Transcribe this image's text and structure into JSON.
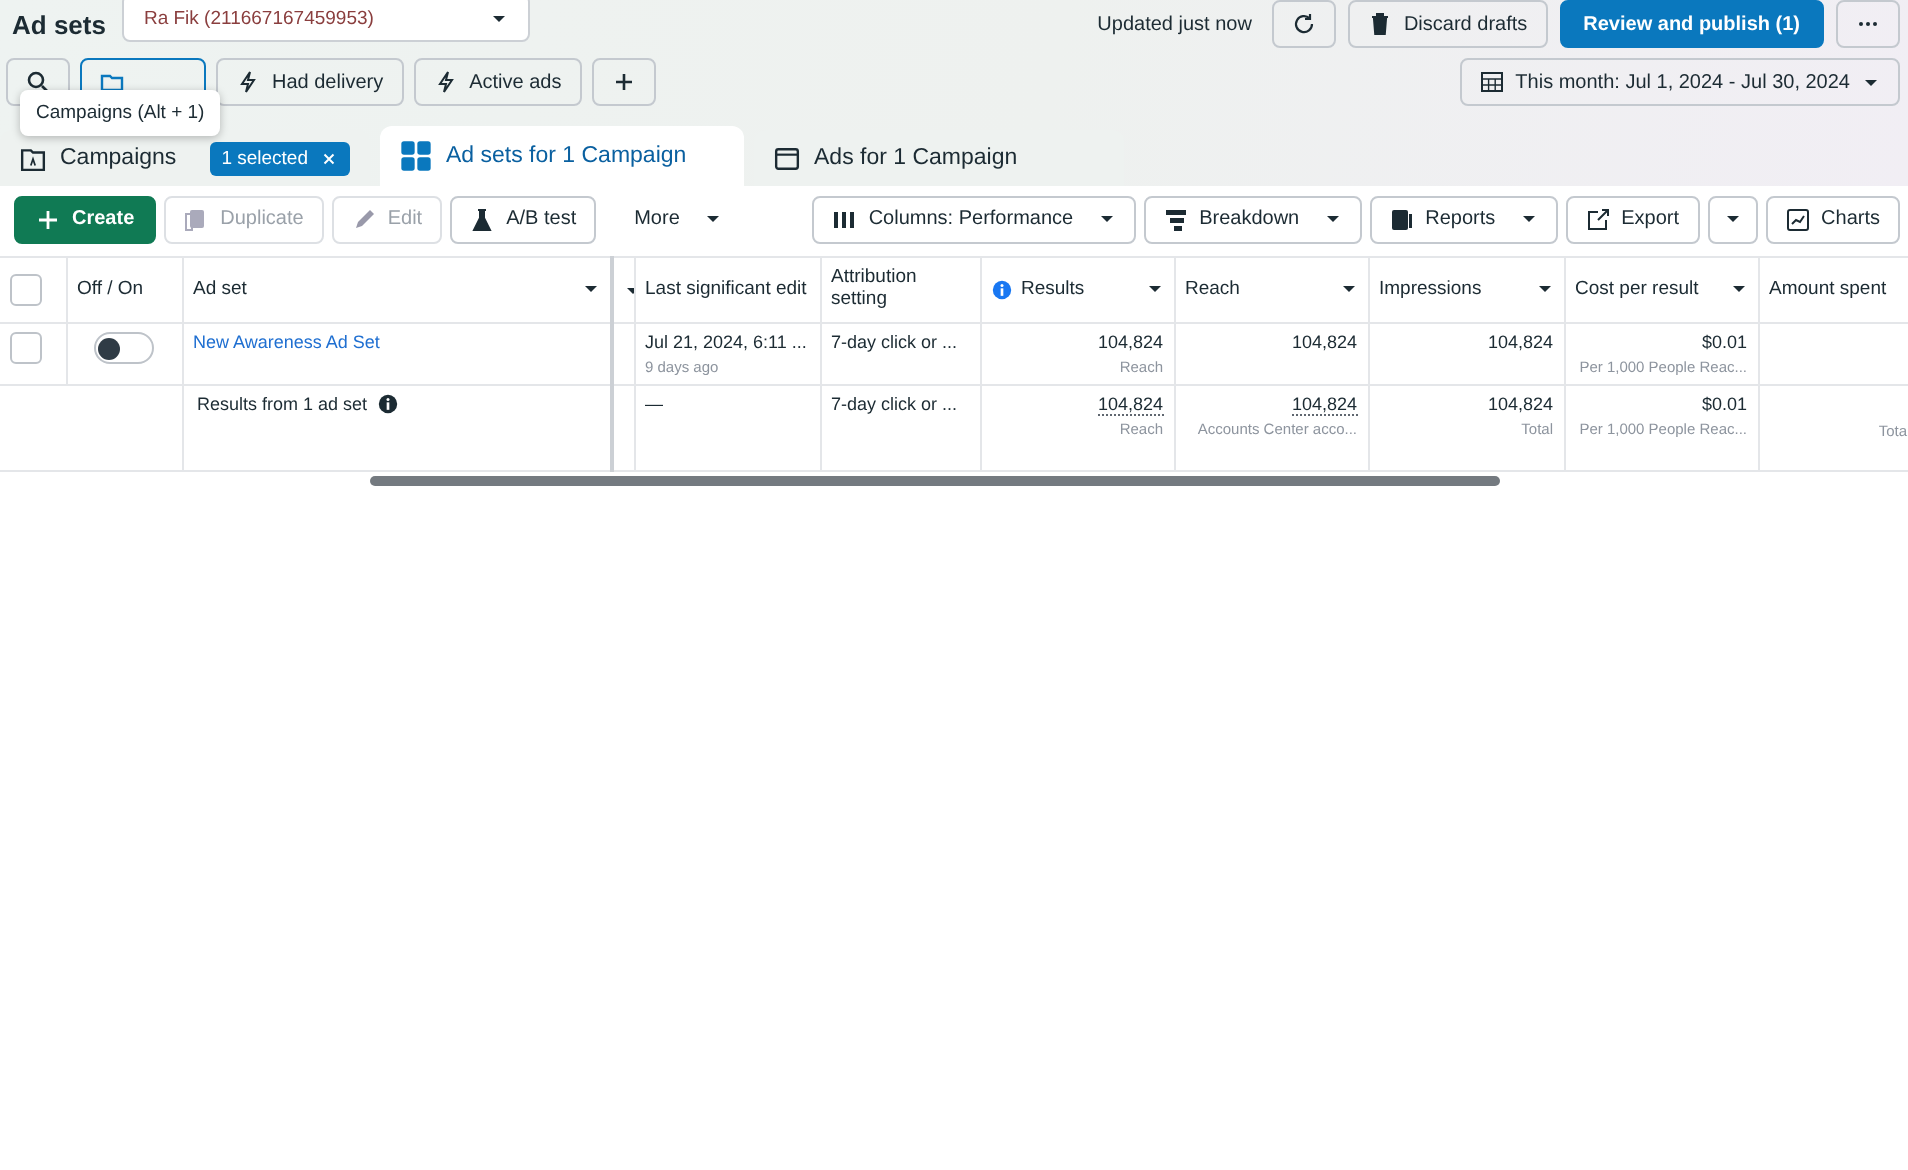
{
  "header": {
    "title": "Ad sets",
    "account": "Ra Fik (211667167459953)",
    "updated": "Updated just now",
    "discard": "Discard drafts",
    "publish": "Review and publish (1)"
  },
  "filters": [
    {
      "kind": "search",
      "selected": false
    },
    {
      "kind": "folder",
      "selected": true
    },
    {
      "kind": "bolt",
      "label": "Had delivery",
      "selected": false
    },
    {
      "kind": "bolt",
      "label": "Active ads",
      "selected": false
    },
    {
      "kind": "plus",
      "selected": false
    }
  ],
  "tooltip": "Campaigns (Alt + 1)",
  "date_range": "This month: Jul 1, 2024 - Jul 30, 2024",
  "tabs": [
    {
      "kind": "campaigns",
      "label": "Campaigns",
      "badge": "1 selected",
      "selected": false
    },
    {
      "kind": "adsets",
      "label": "Ad sets for 1 Campaign",
      "selected": true
    },
    {
      "kind": "ads",
      "label": "Ads for 1 Campaign",
      "selected": false
    }
  ],
  "toolbar": [
    {
      "kind": "create",
      "label": "Create",
      "disabled": false
    },
    {
      "kind": "duplicate",
      "label": "Duplicate",
      "disabled": true
    },
    {
      "kind": "edit",
      "label": "Edit",
      "disabled": true
    },
    {
      "kind": "abtest",
      "label": "A/B test",
      "disabled": false
    },
    {
      "kind": "more",
      "label": "More",
      "disabled": false
    },
    {
      "kind": "columns",
      "label": "Columns: Performance",
      "disabled": false
    },
    {
      "kind": "breakdown",
      "label": "Breakdown",
      "disabled": false
    },
    {
      "kind": "reports",
      "label": "Reports",
      "disabled": false
    },
    {
      "kind": "export",
      "label": "Export",
      "disabled": false
    },
    {
      "kind": "charts",
      "label": "Charts",
      "disabled": false
    }
  ],
  "table": {
    "select_all": {
      "checked": false
    },
    "columns": [
      {
        "label": "Off / On",
        "caret": false,
        "info": false
      },
      {
        "label": "Ad set",
        "caret": true,
        "info": false
      },
      {
        "caret": true,
        "info": false
      },
      {
        "label": "Last significant edit",
        "caret": false,
        "info": false
      },
      {
        "label": "Attribution setting",
        "caret": false,
        "info": false
      },
      {
        "label": "Results",
        "caret": true,
        "info": true
      },
      {
        "label": "Reach",
        "caret": true,
        "info": false
      },
      {
        "label": "Impressions",
        "caret": true,
        "info": false
      },
      {
        "label": "Cost per result",
        "caret": true,
        "info": false
      },
      {
        "label": "Amount spent",
        "caret": false,
        "info": false
      }
    ],
    "rows": [
      {
        "checked": false,
        "on": false,
        "name": "New Awareness Ad Set",
        "last_edit": "Jul 21, 2024, 6:11 ...",
        "last_edit_sub": "9 days ago",
        "attribution": "7-day click or ...",
        "results": "104,824",
        "results_sub": "Reach",
        "reach": "104,824",
        "impressions": "104,824",
        "cost": "$0.01",
        "cost_sub": "Per 1,000 People Reac..."
      }
    ],
    "summary": {
      "label": "Results from 1 ad set",
      "last_edit": "—",
      "attribution": "7-day click or ...",
      "results": "104,824",
      "results_sub": "Reach",
      "reach": "104,824",
      "reach_sub": "Accounts Center acco...",
      "impressions": "104,824",
      "impressions_sub": "Total",
      "cost": "$0.01",
      "cost_sub": "Per 1,000 People Reac...",
      "amount_sub": "Tota"
    }
  }
}
